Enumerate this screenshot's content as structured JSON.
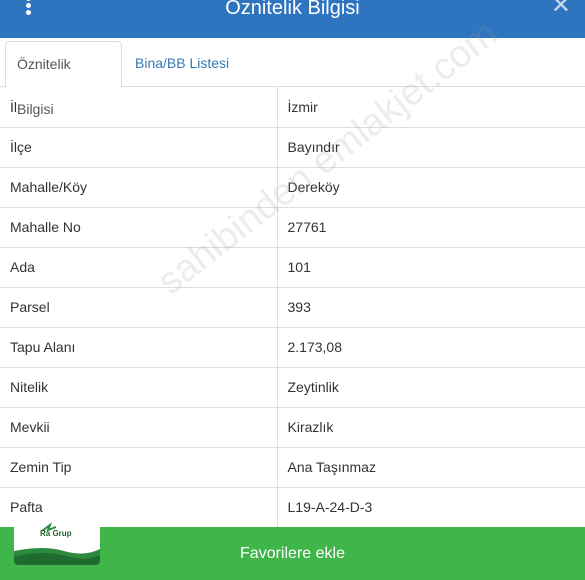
{
  "header": {
    "title": "Öznitelik Bilgisi",
    "close_symbol": "✕",
    "menu_icon": "kebab-menu-icon"
  },
  "tabs": [
    {
      "label": "Öznitelik Bilgisi",
      "active": true
    },
    {
      "label": "Bina/BB Listesi",
      "active": false
    }
  ],
  "attributes": [
    {
      "key": "İl",
      "value": "İzmir"
    },
    {
      "key": "İlçe",
      "value": "Bayındır"
    },
    {
      "key": "Mahalle/Köy",
      "value": "Dereköy"
    },
    {
      "key": "Mahalle No",
      "value": "27761"
    },
    {
      "key": "Ada",
      "value": "101"
    },
    {
      "key": "Parsel",
      "value": "393"
    },
    {
      "key": "Tapu Alanı",
      "value": "2.173,08"
    },
    {
      "key": "Nitelik",
      "value": "Zeytinlik"
    },
    {
      "key": "Mevkii",
      "value": "Kirazlık"
    },
    {
      "key": "Zemin Tip",
      "value": "Ana Taşınmaz"
    },
    {
      "key": "Pafta",
      "value": "L19-A-24-D-3"
    }
  ],
  "watermark": "sahibinden emlakjet.com",
  "logo": {
    "name": "Ra Grup"
  },
  "footer": {
    "button_label": "Favorilere ekle"
  },
  "colors": {
    "header": "#2f74bf",
    "footer": "#3fb54a",
    "tab_link": "#337ab7"
  }
}
